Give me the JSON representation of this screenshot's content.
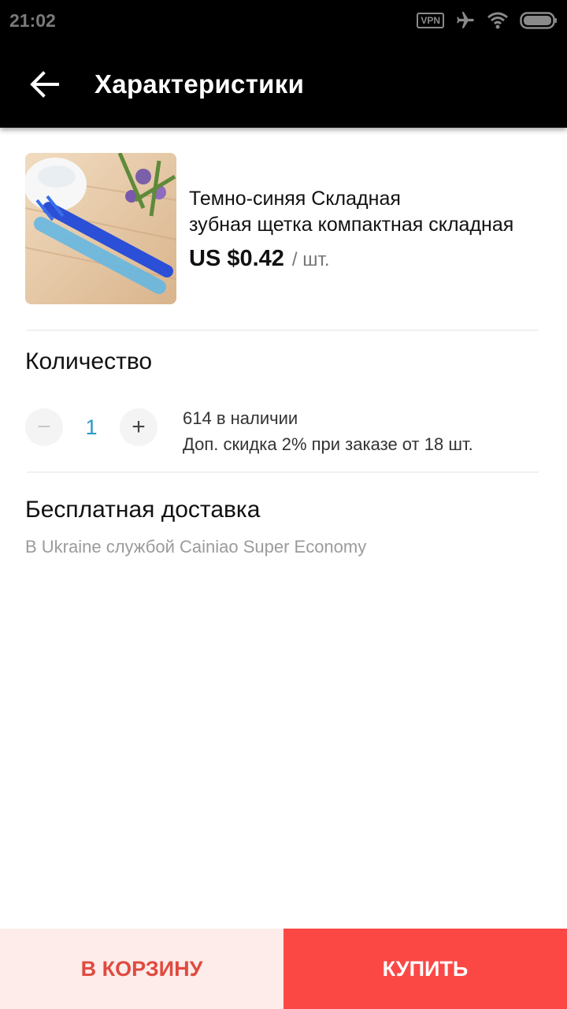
{
  "status_bar": {
    "time": "21:02",
    "vpn_label": "VPN",
    "icons": [
      "vpn-icon",
      "airplane-icon",
      "wifi-icon",
      "battery-icon"
    ]
  },
  "app_bar": {
    "back_icon": "arrow-left-icon",
    "title": "Характеристики"
  },
  "product": {
    "image_description_icon": "product-image",
    "title_line1": "Темно-синяя Складная",
    "title_line2": "зубная щетка компактная складная",
    "price": "US $0.42",
    "unit": "/ шт."
  },
  "quantity": {
    "title": "Количество",
    "minus_label": "−",
    "plus_label": "+",
    "value": "1",
    "stock": "614 в наличии",
    "discount": "Доп. скидка 2% при заказе от 18 шт."
  },
  "delivery": {
    "title": "Бесплатная доставка",
    "subtitle": "В Ukraine службой Cainiao Super Economy"
  },
  "actions": {
    "cart_label": "В КОРЗИНУ",
    "buy_label": "КУПИТЬ"
  },
  "colors": {
    "accent": "#fb4845",
    "cart_bg": "#fdecea",
    "cart_text": "#e04a3f",
    "quantity_value": "#2a99c6"
  }
}
